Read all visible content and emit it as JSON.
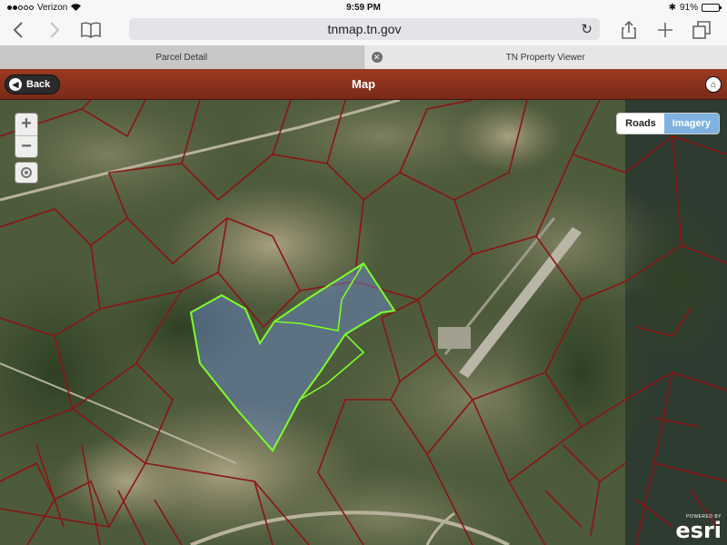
{
  "status_bar": {
    "carrier": "Verizon",
    "time": "9:59 PM",
    "battery": "91%",
    "battery_level": 0.91
  },
  "browser": {
    "url": "tnmap.tn.gov",
    "tabs": [
      {
        "label": "Parcel Detail",
        "active": true
      },
      {
        "label": "TN Property Viewer",
        "active": false
      }
    ]
  },
  "app": {
    "title": "Map",
    "back_label": "Back"
  },
  "map": {
    "zoom_in": "+",
    "zoom_out": "−",
    "basemap": {
      "roads_label": "Roads",
      "imagery_label": "Imagery",
      "selected": "Imagery"
    },
    "attribution": {
      "powered_by": "POWERED BY",
      "brand": "esri"
    },
    "colors": {
      "parcel_boundary": "#8b1414",
      "selected_parcel": "#7cff2a",
      "selected_fill": "#6f8fd6"
    }
  }
}
